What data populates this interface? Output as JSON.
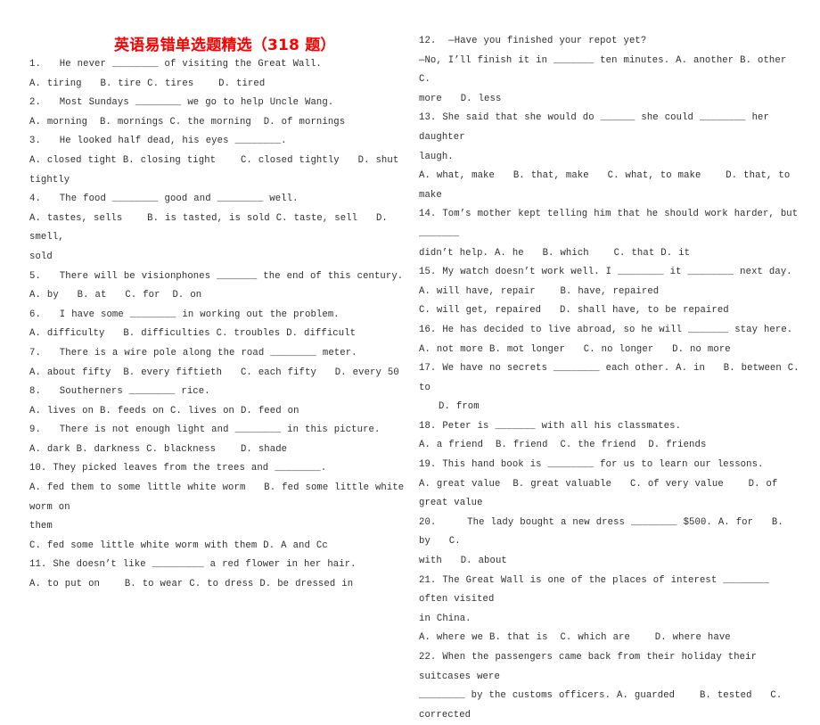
{
  "document": {
    "title": "英语易错单选题精选（318 题）",
    "title_color": "#ff0000",
    "body_color": "#2f2f2f",
    "background": "#ffffff"
  },
  "left_column": {
    "lines": [
      {
        "id": "q1-stem",
        "text": "1.   He never ________ of visiting the Great Wall.",
        "indent": false
      },
      {
        "id": "q1-options",
        "text": "A. tiring   B. tire C. tires    D. tired",
        "indent": false
      },
      {
        "id": "q2-stem",
        "text": "2.   Most Sundays ________ we go to help Uncle Wang.",
        "indent": false
      },
      {
        "id": "q2-options",
        "text": "A. morning  B. mornings C. the morning  D. of mornings",
        "indent": false
      },
      {
        "id": "q3-stem",
        "text": "3.   He looked half dead, his eyes ________.",
        "indent": false
      },
      {
        "id": "q3-options",
        "text": "A. closed tight B. closing tight    C. closed tightly   D. shut tightly",
        "indent": false
      },
      {
        "id": "q4-stem",
        "text": "4.   The food ________ good and ________ well.",
        "indent": false
      },
      {
        "id": "q4-options",
        "text": "A. tastes, sells    B. is tasted, is sold C. taste, sell   D.    smell,",
        "indent": false
      },
      {
        "id": "q4-options2",
        "text": "sold",
        "indent": false
      },
      {
        "id": "q5-stem",
        "text": "5.   There will be visionphones _______ the end of this century.",
        "indent": false
      },
      {
        "id": "q5-options",
        "text": "A. by   B. at   C. for  D. on",
        "indent": false
      },
      {
        "id": "q6-stem",
        "text": "6.   I have some ________ in working out the problem.",
        "indent": false
      },
      {
        "id": "q6-options",
        "text": "A. difficulty   B. difficulties C. troubles D. difficult",
        "indent": false
      },
      {
        "id": "q7-stem",
        "text": "7.   There is a wire pole along the road ________ meter.",
        "indent": false
      },
      {
        "id": "q7-options",
        "text": "A. about fifty  B. every fiftieth   C. each fifty   D. every 50",
        "indent": false
      },
      {
        "id": "q8-stem",
        "text": "8.   Southerners ________ rice.",
        "indent": false
      },
      {
        "id": "q8-options",
        "text": "A. lives on B. feeds on C. lives on D. feed on",
        "indent": false
      },
      {
        "id": "q9-stem",
        "text": "9.   There is not enough light and ________ in this picture.",
        "indent": false
      },
      {
        "id": "q9-options",
        "text": "A. dark B. darkness C. blackness    D. shade",
        "indent": false
      },
      {
        "id": "q10-stem",
        "text": "10. They picked leaves from the trees and ________.",
        "indent": false
      },
      {
        "id": "q10-optionsA",
        "text": "A. fed them to some little white worm   B. fed some little white worm on",
        "indent": false
      },
      {
        "id": "q10-optionsA2",
        "text": "them",
        "indent": false
      },
      {
        "id": "q10-optionsC",
        "text": "C. fed some little white worm with them D. A and Cc",
        "indent": false
      },
      {
        "id": "q11-stem",
        "text": "11. She doesn’t like _________ a red flower in her hair.",
        "indent": false
      },
      {
        "id": "q11-options",
        "text": "A. to put on    B. to wear C. to dress D. be dressed in",
        "indent": false
      }
    ]
  },
  "right_column": {
    "lines": [
      {
        "id": "q12-stem",
        "text": "12.  —Have you finished your repot yet?",
        "indent": false
      },
      {
        "id": "q12-answer",
        "text": "—No, I’ll finish it in _______ ten minutes. A. another B. other    C.",
        "indent": false
      },
      {
        "id": "q12-answer2",
        "text": "more   D. less",
        "indent": false
      },
      {
        "id": "q13-stem",
        "text": "13. She said that she would do ______ she could ________ her daughter",
        "indent": false
      },
      {
        "id": "q13-stem2",
        "text": "laugh.",
        "indent": false
      },
      {
        "id": "q13-options",
        "text": "A. what, make   B. that, make   C. what, to make    D. that, to make",
        "indent": false
      },
      {
        "id": "q14-stem",
        "text": "14. Tom’s mother kept telling him that he should work harder, but _______",
        "indent": false
      },
      {
        "id": "q14-options",
        "text": "didn’t help. A. he   B. which    C. that D. it",
        "indent": false
      },
      {
        "id": "q15-stem",
        "text": "15. My watch doesn’t work well. I ________ it ________ next day.",
        "indent": false
      },
      {
        "id": "q15-optionsA",
        "text": "A. will have, repair    B. have, repaired",
        "indent": false
      },
      {
        "id": "q15-optionsC",
        "text": "C. will get, repaired   D. shall have, to be repaired",
        "indent": false
      },
      {
        "id": "q16-stem",
        "text": "16. He has decided to live abroad, so he will _______ stay here.",
        "indent": false
      },
      {
        "id": "q16-options",
        "text": "A. not more B. mot longer   C. no longer   D. no more",
        "indent": false
      },
      {
        "id": "q17-stem",
        "text": "17. We have no secrets ________ each other. A. in   B. between C.     to",
        "indent": false
      },
      {
        "id": "q17-options",
        "text": "D. from",
        "indent": true
      },
      {
        "id": "q18-stem",
        "text": "18. Peter is _______ with all his classmates.",
        "indent": false
      },
      {
        "id": "q18-options",
        "text": "A. a friend  B. friend  C. the friend  D. friends",
        "indent": false
      },
      {
        "id": "q19-stem",
        "text": "19. This hand book is ________ for us to learn our lessons.",
        "indent": false
      },
      {
        "id": "q19-options",
        "text": "A. great value  B. great valuable   C. of very value    D. of great value",
        "indent": false
      },
      {
        "id": "q20-stem",
        "text": "20.     The lady bought a new dress ________ $500. A. for   B. by   C.",
        "indent": false
      },
      {
        "id": "q20-options",
        "text": "with   D. about",
        "indent": false
      },
      {
        "id": "q21-stem",
        "text": "21. The Great Wall is one of the places of interest ________ often visited",
        "indent": false
      },
      {
        "id": "q21-stem2",
        "text": "in China.",
        "indent": false
      },
      {
        "id": "q21-options",
        "text": "A. where we B. that is  C. which are    D. where have",
        "indent": false
      },
      {
        "id": "q22-stem",
        "text": "22. When the passengers came back from their holiday their suitcases were",
        "indent": false
      },
      {
        "id": "q22-stem2",
        "text": "________ by the customs officers. A. guarded    B. tested   C. corrected",
        "indent": false
      }
    ]
  }
}
